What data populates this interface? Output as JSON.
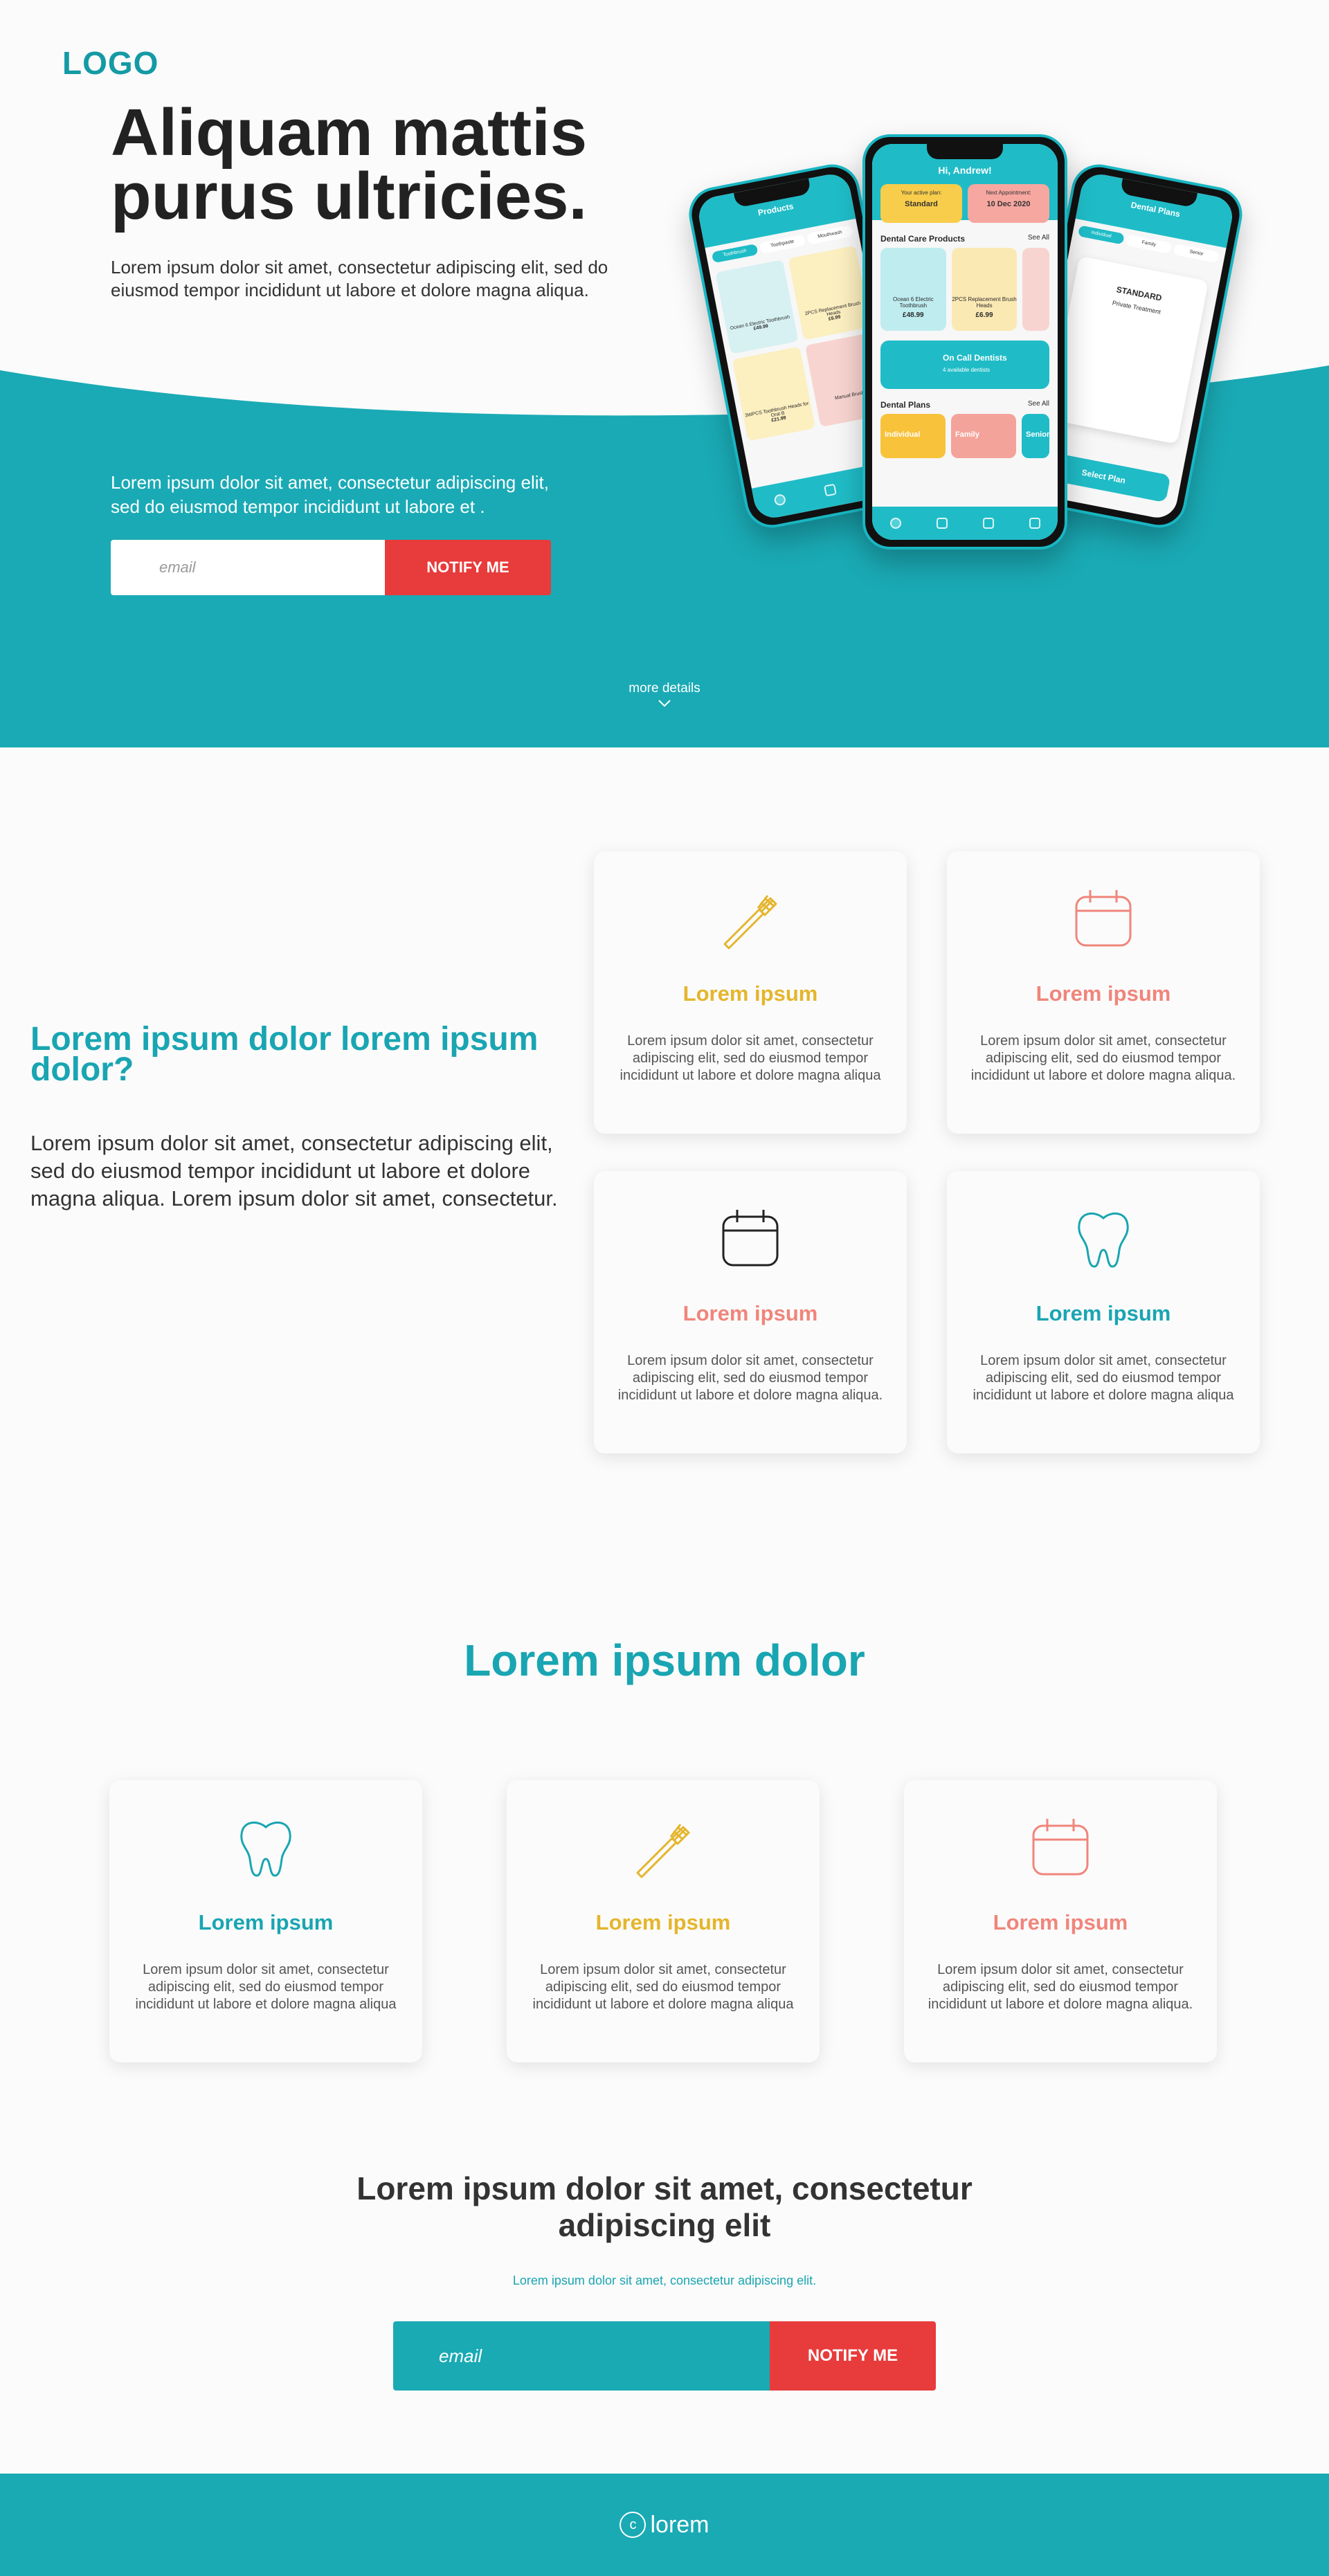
{
  "brand": {
    "logo": "LOGO"
  },
  "hero": {
    "title": "Aliquam mattis purus ultricies.",
    "subtitle": "Lorem ipsum dolor sit amet, consectetur adipiscing elit, sed do eiusmod tempor incididunt ut labore et dolore magna aliqua.",
    "subtitle2": "Lorem ipsum dolor sit amet, consectetur adipiscing elit, sed do eiusmod tempor incididunt ut labore et .",
    "email_placeholder": "email",
    "notify_label": "NOTIFY ME",
    "more_details": "more details"
  },
  "phone_center": {
    "greeting": "Hi, Andrew!",
    "active_plan_label": "Your active plan:",
    "active_plan": "Standard",
    "appointment_label": "Next Appointment:",
    "appointment": "10 Dec 2020",
    "products_heading": "Dental Care Products",
    "see_all": "See All",
    "products": [
      {
        "name": "Ocean 6 Electric Toothbrush",
        "price": "£48.99"
      },
      {
        "name": "2PCS Replacement Brush Heads",
        "price": "£6.99"
      }
    ],
    "oncall_title": "On Call Dentists",
    "oncall_sub": "4 available dentists",
    "plans_heading": "Dental Plans",
    "plans": [
      "Individual",
      "Family",
      "Senior"
    ]
  },
  "phone_left": {
    "title": "Products",
    "tabs": [
      "Toothbrush",
      "Toothpaste",
      "Mouthwash"
    ],
    "items": [
      {
        "name": "Ocean 6 Electric Toothbrush",
        "price": "£49.99"
      },
      {
        "name": "2PCS Replacement Brush Heads",
        "price": "£6.99"
      },
      {
        "name": "3WPCS Toothbrush Heads for Oral B",
        "price": "£21.99"
      },
      {
        "name": "Manual Brush",
        "price": ""
      }
    ]
  },
  "phone_right": {
    "title": "Dental Plans",
    "tabs": [
      "Individual",
      "Family",
      "Senior"
    ],
    "plan_name": "STANDARD",
    "plan_sub": "Private Treatment",
    "button": "Select Plan"
  },
  "features": {
    "title": "Lorem ipsum dolor lorem ipsum dolor?",
    "text": "Lorem ipsum dolor sit amet, consectetur adipiscing elit, sed do eiusmod tempor incididunt ut labore et dolore magna aliqua. Lorem ipsum dolor sit amet, consectetur.",
    "cards": [
      {
        "title": "Lorem ipsum",
        "icon": "toothbrush-icon",
        "color": "#e5b52c",
        "text": "Lorem ipsum dolor sit amet, consectetur adipiscing elit, sed do eiusmod tempor incididunt ut labore et dolore magna aliqua"
      },
      {
        "title": "Lorem ipsum",
        "icon": "calendar-icon",
        "color": "#f0857b",
        "text": "Lorem ipsum dolor sit amet, consectetur adipiscing elit, sed do eiusmod tempor incididunt ut labore et dolore magna aliqua."
      },
      {
        "title": "Lorem ipsum",
        "icon": "calendar-icon",
        "color": "#f0857b",
        "text": "Lorem ipsum dolor sit amet, consectetur adipiscing elit, sed do eiusmod tempor incididunt ut labore et dolore magna aliqua."
      },
      {
        "title": "Lorem ipsum",
        "icon": "tooth-icon",
        "color": "#19a5b2",
        "text": "Lorem ipsum dolor sit amet, consectetur adipiscing elit, sed do eiusmod tempor incididunt ut labore et dolore magna aliqua"
      }
    ]
  },
  "section2": {
    "title": "Lorem ipsum dolor",
    "cards": [
      {
        "title": "Lorem ipsum",
        "icon": "tooth-icon",
        "color": "#19a5b2",
        "text": "Lorem ipsum dolor sit amet, consectetur adipiscing elit, sed do eiusmod tempor incididunt ut labore et dolore magna aliqua"
      },
      {
        "title": "Lorem ipsum",
        "icon": "toothbrush-icon",
        "color": "#e5b52c",
        "text": "Lorem ipsum dolor sit amet, consectetur adipiscing elit, sed do eiusmod tempor incididunt ut labore et dolore magna aliqua"
      },
      {
        "title": "Lorem ipsum",
        "icon": "calendar-icon",
        "color": "#f0857b",
        "text": "Lorem ipsum dolor sit amet, consectetur adipiscing elit, sed do eiusmod tempor incididunt ut labore et dolore magna aliqua."
      }
    ]
  },
  "cta": {
    "title": "Lorem ipsum dolor sit amet, consectetur adipiscing elit",
    "subtitle": "Lorem ipsum dolor sit amet, consectetur adipiscing elit.",
    "email_placeholder": "email",
    "notify_label": "NOTIFY ME"
  },
  "footer": {
    "copyright_symbol": "c",
    "text": "lorem"
  },
  "colors": {
    "teal": "#19a5b2",
    "red": "#e83b3b",
    "yellow": "#e5b52c",
    "pink": "#f0857b"
  }
}
